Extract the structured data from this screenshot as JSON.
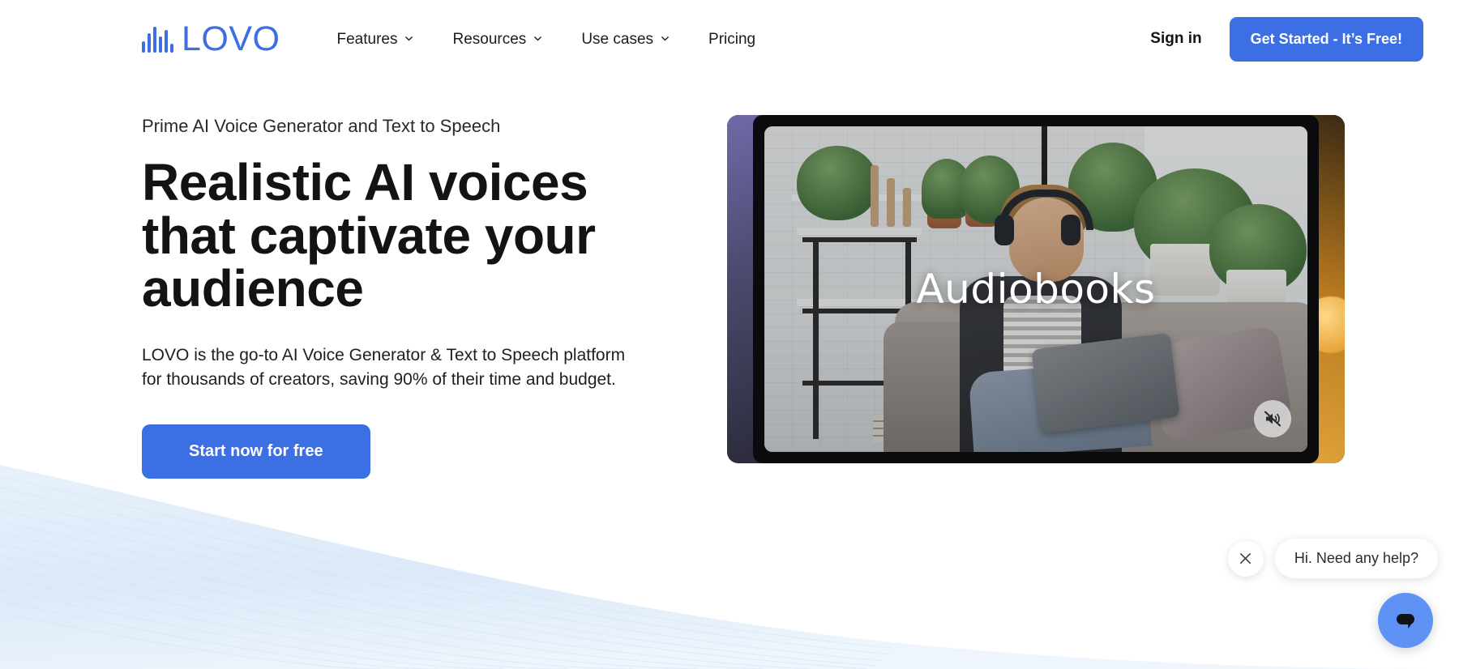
{
  "brand": {
    "name": "LOVO",
    "logo_icon": "waveform-icon",
    "accent_color": "#3c6fe3",
    "logo_color": "#3d6fe0"
  },
  "header": {
    "nav_items": [
      {
        "label": "Features",
        "has_dropdown": true,
        "icon": "chevron-down-icon"
      },
      {
        "label": "Resources",
        "has_dropdown": true,
        "icon": "chevron-down-icon"
      },
      {
        "label": "Use cases",
        "has_dropdown": true,
        "icon": "chevron-down-icon"
      },
      {
        "label": "Pricing",
        "has_dropdown": false,
        "icon": ""
      }
    ],
    "signin_label": "Sign in",
    "cta_label": "Get Started - It’s Free!"
  },
  "hero": {
    "eyebrow": "Prime AI Voice Generator and Text to Speech",
    "headline": "Realistic AI voices that captivate your audience",
    "subcopy": "LOVO is the go-to AI Voice Generator & Text to Speech platform for thousands of creators, saving 90% of their time and budget.",
    "cta_label": "Start now for free"
  },
  "media": {
    "caption": "Audiobooks",
    "mute_icon": "mute-speaker-icon",
    "mute_state": "muted",
    "side_slide_left_color": "#4a4a6e",
    "side_slide_right_color": "#e0a23a"
  },
  "chat": {
    "message": "Hi. Need any help?",
    "close_icon": "close-icon",
    "fab_icon": "chat-bubble-icon",
    "fab_color": "#5f92f5"
  },
  "decor": {
    "wave_color": "#dce9f8"
  }
}
